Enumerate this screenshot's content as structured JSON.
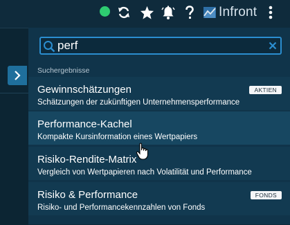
{
  "header": {
    "brand_name": "Infront",
    "status_color": "#2ecc71",
    "icons": [
      "refresh-icon",
      "star-icon",
      "bell-icon",
      "help-icon",
      "more-icon"
    ]
  },
  "search": {
    "value": "perf",
    "placeholder": ""
  },
  "section_label": "Suchergebnisse",
  "results": [
    {
      "title": "Gewinnschätzungen",
      "description": "Schätzungen der zukünftigen Unternehmensperformance",
      "badge": "AKTIEN"
    },
    {
      "title": "Performance-Kachel",
      "description": "Kompakte Kursinformation eines Wertpapiers",
      "badge": ""
    },
    {
      "title": "Risiko-Rendite-Matrix",
      "description": "Vergleich von Wertpapieren nach Volatilität und Performance",
      "badge": ""
    },
    {
      "title": "Risiko & Performance",
      "description": "Risiko- und Performancekennzahlen von Fonds",
      "badge": "FONDS"
    }
  ],
  "colors": {
    "accent": "#2b8ed0",
    "background": "#10344a",
    "hover_row": "#174761"
  }
}
